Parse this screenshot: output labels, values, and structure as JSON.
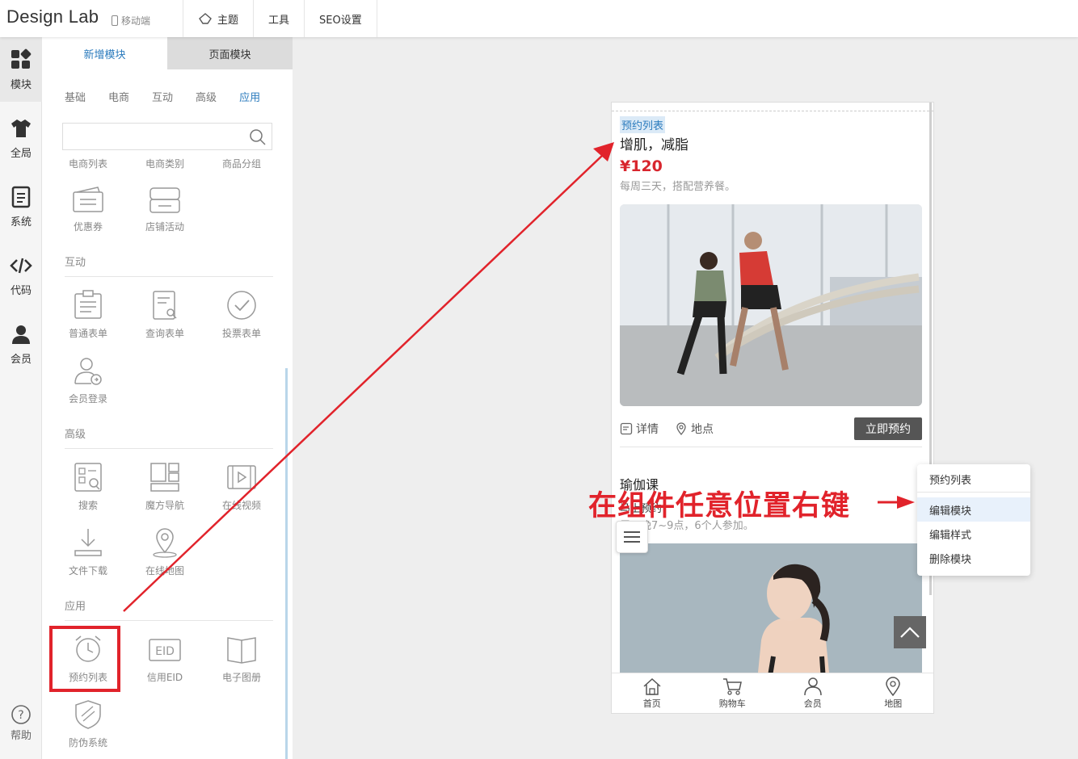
{
  "app": {
    "logo": "Design Lab",
    "device_label": "移动端"
  },
  "topnav": [
    {
      "label": "主题",
      "icon": "theme-icon"
    },
    {
      "label": "工具"
    },
    {
      "label": "SEO设置"
    }
  ],
  "iconbar": [
    {
      "label": "模块",
      "icon": "modules-icon",
      "active": true
    },
    {
      "label": "全局",
      "icon": "tshirt-icon"
    },
    {
      "label": "系统",
      "icon": "document-icon"
    },
    {
      "label": "代码",
      "icon": "code-icon"
    },
    {
      "label": "会员",
      "icon": "user-icon"
    }
  ],
  "help": {
    "label": "帮助",
    "icon": "help-icon"
  },
  "panel": {
    "tabs": [
      "新增模块",
      "页面模块"
    ],
    "subtabs": [
      "基础",
      "电商",
      "互动",
      "高级",
      "应用"
    ],
    "search_placeholder": "",
    "ecommerce_items": [
      "电商列表",
      "电商类别",
      "商品分组",
      "优惠券",
      "店铺活动"
    ],
    "sections": {
      "interactive": {
        "title": "互动",
        "items": [
          "普通表单",
          "查询表单",
          "投票表单",
          "会员登录"
        ]
      },
      "advanced": {
        "title": "高级",
        "items": [
          "搜索",
          "魔方导航",
          "在线视频",
          "文件下载",
          "在线地图"
        ]
      },
      "apps": {
        "title": "应用",
        "items": [
          "预约列表",
          "信用EID",
          "电子图册",
          "防伪系统"
        ]
      }
    }
  },
  "preview": {
    "tag": "预约列表",
    "card1": {
      "title": "增肌，减脂",
      "price": "¥120",
      "desc": "每周三天，搭配营养餐。",
      "details": "详情",
      "location": "地点",
      "book": "立即预约"
    },
    "card2": {
      "title": "瑜伽课",
      "subtitle": "马上预约",
      "desc": "周四晚7~9点，6个人参加。"
    },
    "bottom_nav": [
      "首页",
      "购物车",
      "会员",
      "地图"
    ]
  },
  "context_menu": {
    "header": "预约列表",
    "items": [
      "编辑模块",
      "编辑样式",
      "删除模块"
    ]
  },
  "annotation": "在组件任意位置右键",
  "colors": {
    "accent": "#2b7bbd",
    "annotation_red": "#e1232b",
    "price_red": "#d8262e"
  }
}
